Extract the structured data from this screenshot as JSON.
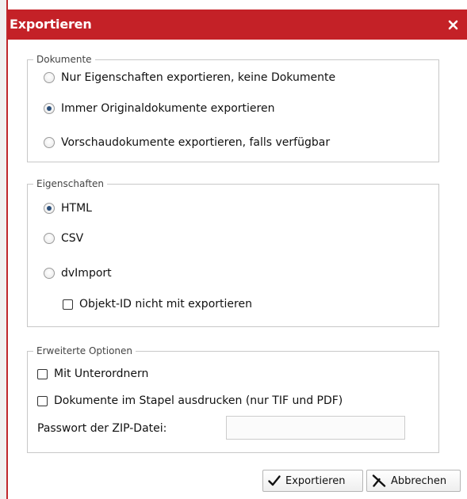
{
  "dialog": {
    "title": "Exportieren",
    "close_icon": "close-icon"
  },
  "documents": {
    "legend": "Dokumente",
    "options": [
      {
        "label": "Nur Eigenschaften exportieren, keine Dokumente",
        "checked": false
      },
      {
        "label": "Immer Originaldokumente exportieren",
        "checked": true
      },
      {
        "label": "Vorschaudokumente exportieren, falls verfügbar",
        "checked": false
      }
    ]
  },
  "properties": {
    "legend": "Eigenschaften",
    "options": [
      {
        "label": "HTML",
        "checked": true
      },
      {
        "label": "CSV",
        "checked": false
      },
      {
        "label": "dvImport",
        "checked": false
      }
    ],
    "objectid_checkbox": {
      "label": "Objekt-ID nicht mit exportieren",
      "checked": false
    }
  },
  "advanced": {
    "legend": "Erweiterte Optionen",
    "subfolders": {
      "label": "Mit Unterordnern",
      "checked": false
    },
    "batch_print": {
      "label": "Dokumente im Stapel ausdrucken (nur TIF und PDF)",
      "checked": false
    },
    "zip_password": {
      "label": "Passwort der ZIP-Datei:",
      "value": ""
    }
  },
  "buttons": {
    "export": {
      "label": "Exportieren",
      "icon": "checkmark-icon"
    },
    "cancel": {
      "label": "Abbrechen",
      "icon": "cross-icon"
    }
  },
  "colors": {
    "titlebar": "#c42127",
    "title_text": "#ffffff",
    "radio_selected": "#2b4f7a"
  }
}
